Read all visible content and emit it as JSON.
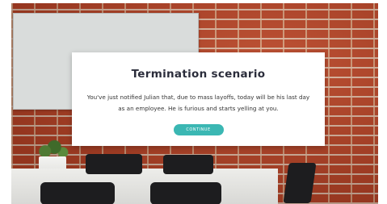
{
  "modal": {
    "title": "Termination scenario",
    "body": "You've just notified Julian that, due to mass layoffs, today will be his last day as an employee. He is furious and starts yelling at you.",
    "button_label": "CONTINUE"
  },
  "colors": {
    "accent": "#3bb7b3",
    "title_text": "#2b2d3b",
    "brick": "#b04328"
  }
}
